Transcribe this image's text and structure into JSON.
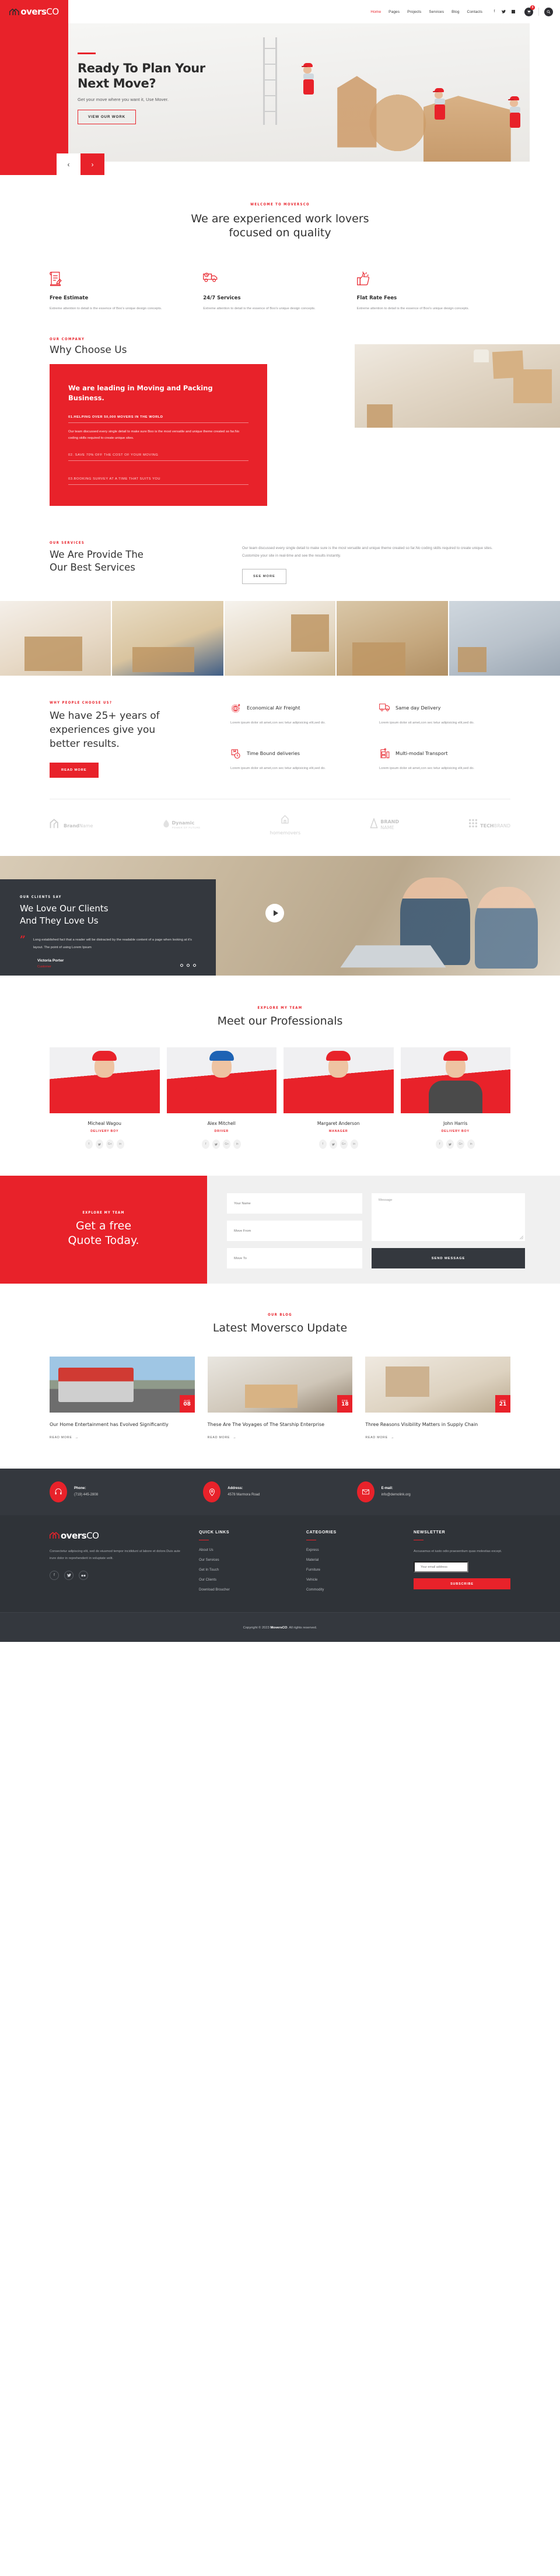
{
  "brand": {
    "name_bold": "M",
    "name_part1": "overs",
    "name_part2": "CO",
    "accent": "#e8222a",
    "dark": "#34383e"
  },
  "header": {
    "nav": [
      {
        "label": "Home",
        "active": true
      },
      {
        "label": "Pages",
        "active": false
      },
      {
        "label": "Projects",
        "active": false
      },
      {
        "label": "Services",
        "active": false
      },
      {
        "label": "Blog",
        "active": false
      },
      {
        "label": "Contacts",
        "active": false
      }
    ],
    "social": [
      "facebook-icon",
      "twitter-icon",
      "flickr-icon"
    ],
    "cart_count": "0",
    "search_label": "search-icon"
  },
  "hero": {
    "title_line1": "Ready To Plan Your",
    "title_line2": "Next Move?",
    "subtitle": "Get your move where you want it, Use Mover.",
    "button": "VIEW OUR WORK",
    "prev": "‹",
    "next": "›"
  },
  "welcome": {
    "eyebrow": "WELCOME TO MOVERSCO",
    "title_line1": "We are experienced work lovers",
    "title_line2": "focused on quality",
    "features": [
      {
        "icon": "document-estimate-icon",
        "title": "Free Estimate",
        "text": "Extreme attention to detail is the essence of Boo's unique design concepts."
      },
      {
        "icon": "truck-clock-icon",
        "title": "24/7 Services",
        "text": "Extreme attention to detail is the essence of Boo's unique design concepts."
      },
      {
        "icon": "thumbs-up-icon",
        "title": "Flat Rate Fees",
        "text": "Extreme attention to detail is the essence of Boo's unique design concepts."
      }
    ]
  },
  "why_choose": {
    "eyebrow": "OUR COMPANY",
    "title": "Why Choose Us",
    "card_title": "We are leading in Moving and Packing Business.",
    "accordion": [
      {
        "title": "01.HELPING OVER 50,000 MOVERS IN THE WORLD",
        "body": "Our team discussed every single detail to make sure Boo is the most versatile and unique theme created so far.No coding skills required to create unique sites.",
        "open": true
      },
      {
        "title": "02. SAVE 70% OFF THE COST OF YOUR MOVING",
        "body": "",
        "open": false
      },
      {
        "title": "03.BOOKING SURVEY AT A TIME THAT SUITS YOU",
        "body": "",
        "open": false
      }
    ]
  },
  "services": {
    "eyebrow": "OUR SERVICES",
    "title_line1": "We Are Provide The",
    "title_line2": "Our Best Services",
    "text": "Our team discussed every single detail to make sure is the most versatile and unique theme created so far.No coding skills required to create unique sites. Customize your site in real-time and see the results instantly.",
    "button": "SEE MORE",
    "gallery": [
      "couple-packing-box-photo",
      "workers-taping-box-photo",
      "couple-sitting-boxes-photo",
      "delivery-signature-photo",
      "moving-truck-loading-photo"
    ]
  },
  "why_people": {
    "eyebrow": "WHY PEOPLE CHOOSE US?",
    "title_line1": "We have 25+ years of",
    "title_line2": "experiences give you",
    "title_line3": "better results.",
    "button": "READ MORE",
    "items": [
      {
        "icon": "globe-air-freight-icon",
        "title": "Economical Air Freight",
        "text": "Lorem ipsum dolor sit amet,con sec tetur adipisicing elit,sed do."
      },
      {
        "icon": "delivery-truck-icon",
        "title": "Same day Delivery",
        "text": "Lorem ipsum dolor sit amet,con sec tetur adipisicing elit,sed do."
      },
      {
        "icon": "box-clock-icon",
        "title": "Time Bound deliveries",
        "text": "Lorem ipsum dolor sit amet,con sec tetur adipisicing elit,sed do."
      },
      {
        "icon": "crane-container-icon",
        "title": "Multi-modal Transport",
        "text": "Lorem ipsum dolor sit amet,con sec tetur adipisicing elit,sed do."
      }
    ]
  },
  "brands": [
    {
      "icon": "house-logo-icon",
      "bold": "Brand",
      "light": "Name",
      "sub": ""
    },
    {
      "icon": "flame-logo-icon",
      "bold": "Dynamic",
      "light": "",
      "sub": "POWER OF FUTURE"
    },
    {
      "icon": "hand-house-logo-icon",
      "bold": "",
      "light": "homemovers",
      "sub": ""
    },
    {
      "icon": "triangle-logo-icon",
      "bold": "BRAND",
      "light": "NAME",
      "sub": ""
    },
    {
      "icon": "dots-logo-icon",
      "bold": "TECH",
      "light": "BRAND",
      "sub": ""
    }
  ],
  "testimonial": {
    "eyebrow": "OUR CLIENTS SAY",
    "title_line1": "We Love Our Clients",
    "title_line2": "And They Love Us",
    "quote_mark": "”",
    "quote": "Long established fact that a reader will be distracted by the readable content of a page when looking at it's layout. The point of using Lorem Ipsum",
    "author": "Victoria Porter",
    "role": "Customer",
    "dots": 3,
    "play_label": "play-video-button"
  },
  "team": {
    "eyebrow": "EXPLORE MY TEAM",
    "title": "Meet our Professionals",
    "members": [
      {
        "name": "Micheal Wagou",
        "role": "DELIVERY BOY",
        "socials": [
          "f",
          "\u0001",
          "G+",
          "in"
        ]
      },
      {
        "name": "Alex Mitchell",
        "role": "DRIVER",
        "socials": [
          "f",
          "\u0001",
          "G+",
          "in"
        ]
      },
      {
        "name": "Margaret Anderson",
        "role": "MANAGER",
        "socials": [
          "f",
          "\u0001",
          "G+",
          "in"
        ]
      },
      {
        "name": "John Harris",
        "role": "DELIVERY BOY",
        "socials": [
          "f",
          "\u0001",
          "G+",
          "in"
        ]
      }
    ]
  },
  "quote_form": {
    "eyebrow": "EXPLORE MY TEAM",
    "title_line1": "Get a free",
    "title_line2": "Quote Today.",
    "fields": [
      {
        "name": "your-name",
        "placeholder": "Your Name",
        "value": ""
      },
      {
        "name": "move-from",
        "placeholder": "Move From",
        "value": ""
      },
      {
        "name": "move-to",
        "placeholder": "Move To",
        "value": ""
      }
    ],
    "message_placeholder": "Message",
    "message_value": "",
    "submit": "SEND MESSAGE"
  },
  "blog": {
    "eyebrow": "OUR BLOG",
    "title": "Latest Moversco Update",
    "posts": [
      {
        "month": "AUG",
        "day": "08",
        "title": "Our Home Entertainment has Evolved Significantly",
        "link": "READ MORE",
        "image": "red-truck-highway-photo"
      },
      {
        "month": "FEB",
        "day": "18",
        "title": "These Are The Voyages of The Starship Enterprise",
        "link": "READ MORE",
        "image": "couple-carrying-boxes-photo"
      },
      {
        "month": "JAN",
        "day": "21",
        "title": "Three Reasons Visibility Matters in Supply Chain",
        "link": "READ MORE",
        "image": "family-sitting-boxes-photo"
      }
    ]
  },
  "contact_bar": [
    {
      "icon": "headset-icon",
      "label": "Phone:",
      "value": "(719) 445-2808"
    },
    {
      "icon": "location-pin-icon",
      "label": "Address:",
      "value": "4578 Marmora Road"
    },
    {
      "icon": "envelope-icon",
      "label": "E-mail:",
      "value": "info@demolink.org"
    }
  ],
  "footer": {
    "about": "Consectetur adipiscing elit, sed do eiusmod tempor incididunt ut labore et dolore.Duis aute irure dolor in reprehenderit in voluptate velit.",
    "social": [
      "facebook-icon",
      "twitter-icon",
      "flickr-icon"
    ],
    "quick_links": {
      "heading": "QUICK LINKS",
      "items": [
        "About Us",
        "Our Services",
        "Get In Touch",
        "Our Clients",
        "Download Broucher"
      ]
    },
    "categories": {
      "heading": "CATEGORIES",
      "items": [
        "Express",
        "Material",
        "Furniture",
        "Vehicle",
        "Commodity"
      ]
    },
    "newsletter": {
      "heading": "NEWSLETTER",
      "text": "Accusamus et iusto odio praesentium quas molestias except.",
      "placeholder": "Your email address",
      "value": "",
      "button": "SUBSCRIBE"
    },
    "copyright_pre": "Copyright © 2023 ",
    "copyright_brand": "MoversCO",
    "copyright_post": ". All rights reserved."
  }
}
